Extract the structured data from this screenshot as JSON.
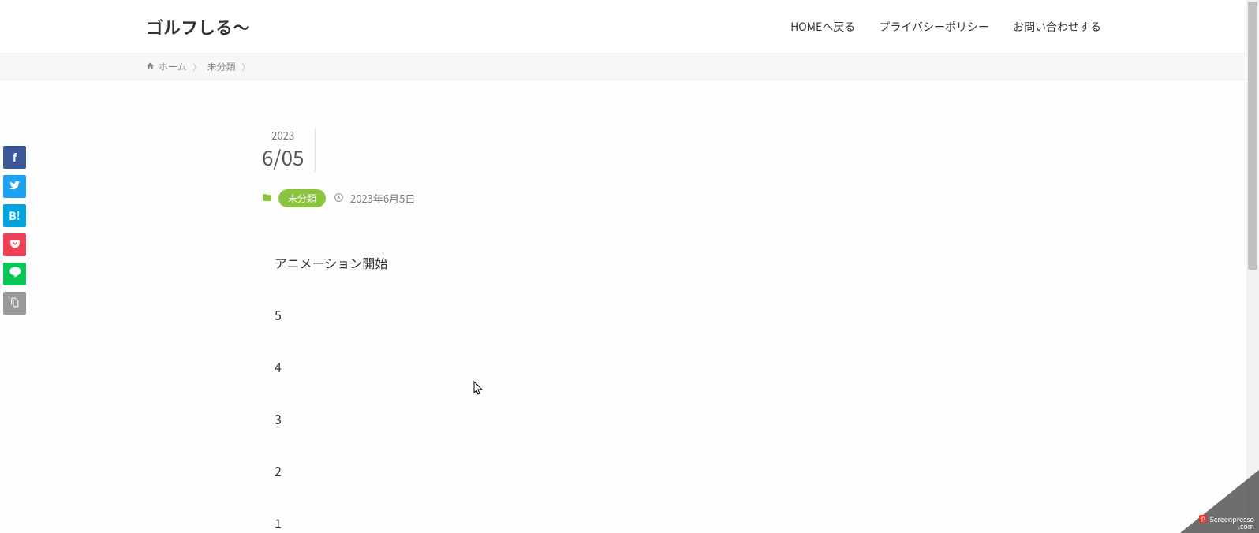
{
  "header": {
    "site_title": "ゴルフしる～",
    "nav": [
      "HOMEへ戻る",
      "プライバシーポリシー",
      "お問い合わせする"
    ]
  },
  "breadcrumb": {
    "home": "ホーム",
    "category": "未分類"
  },
  "social": {
    "facebook": "f",
    "twitter": "",
    "hatena": "B!",
    "pocket": "",
    "line": "",
    "copy": ""
  },
  "post": {
    "year": "2023",
    "month_day": "6/05",
    "category_label": "未分類",
    "date_text": "2023年6月5日",
    "heading": "アニメーション開始",
    "items": [
      "5",
      "4",
      "3",
      "2",
      "1"
    ]
  },
  "corner": {
    "brand": "Screenpresso",
    "suffix": ".com"
  }
}
